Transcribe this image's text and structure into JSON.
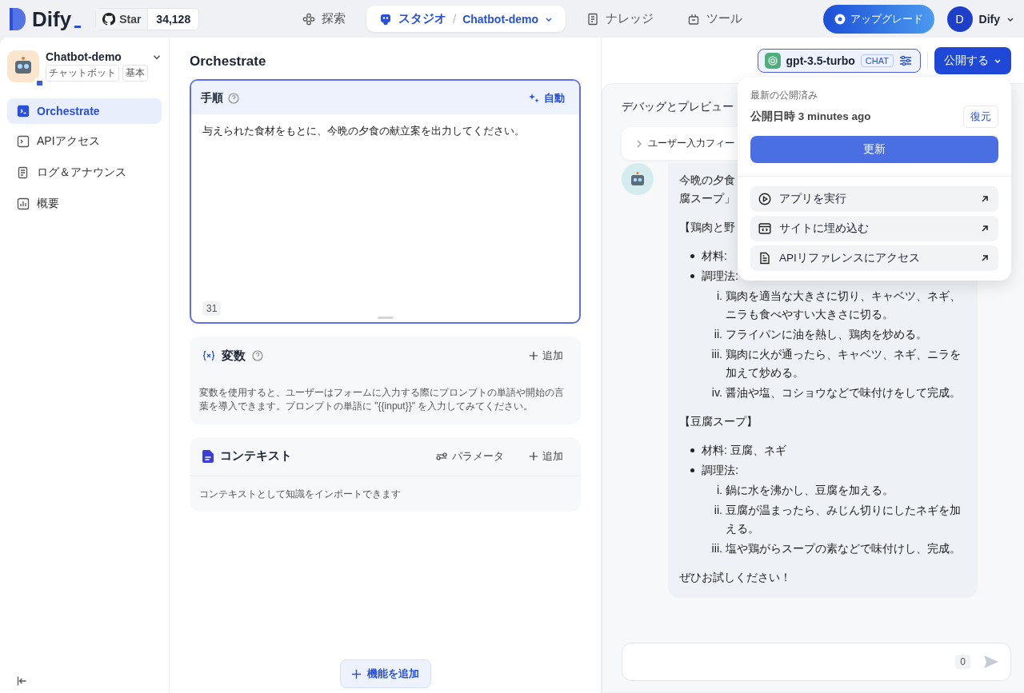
{
  "nav": {
    "logo": "Dify",
    "star": {
      "label": "Star",
      "count": "34,128"
    },
    "items": [
      {
        "kind": "explore",
        "label": "探索",
        "selected": false
      },
      {
        "kind": "studio",
        "label": "スタジオ",
        "separator": "/",
        "app": "Chatbot-demo",
        "selected": true
      },
      {
        "kind": "knowledge",
        "label": "ナレッジ",
        "selected": false
      },
      {
        "kind": "tools",
        "label": "ツール",
        "selected": false
      }
    ],
    "upgrade": "アップグレード",
    "user": {
      "initial": "D",
      "name": "Dify"
    }
  },
  "app": {
    "name": "Chatbot-demo",
    "tags": [
      "チャットボット",
      "基本"
    ]
  },
  "sidebar": {
    "items": [
      {
        "kind": "orchestrate",
        "label": "Orchestrate",
        "selected": true
      },
      {
        "kind": "api",
        "label": "APIアクセス",
        "selected": false
      },
      {
        "kind": "logs",
        "label": "ログ＆アナウンス",
        "selected": false
      },
      {
        "kind": "overview",
        "label": "概要",
        "selected": false
      }
    ]
  },
  "page_title": "Orchestrate",
  "model": {
    "name": "gpt-3.5-turbo",
    "mode": "CHAT"
  },
  "publish_button": "公開する",
  "prompt": {
    "title": "手順",
    "auto": "自動",
    "text": "与えられた食材をもとに、今晩の夕食の献立案を出力してください。",
    "count": "31"
  },
  "variables": {
    "title": "変数",
    "add": "追加",
    "description": "変数を使用すると、ユーザーはフォームに入力する際にプロンプトの単語や開始の言葉を導入できます。プロンプトの単語に \"{{input}}\" を入力してみてください。"
  },
  "context": {
    "title": "コンテキスト",
    "params": "パラメータ",
    "add": "追加",
    "description": "コンテキストとして知識をインポートできます"
  },
  "add_feature": "機能を追加",
  "debug": {
    "title": "デバッグとプレビュー",
    "user_input": "ユーザー入力フィー",
    "input_count": "0",
    "blocks": [
      {
        "kind": "para",
        "lines": [
          "今晩の夕食",
          "腐スープ」"
        ]
      },
      {
        "kind": "para",
        "lines": [
          "【鶏肉と野"
        ]
      },
      {
        "kind": "list",
        "items": [
          {
            "text": "材料:"
          },
          {
            "text": "調理法:",
            "children": [
              {
                "num": "i.",
                "text": "鶏肉を適当な大きさに切り、キャベツ、ネギ、ニラも食べやすい大きさに切る。"
              },
              {
                "num": "ii.",
                "text": "フライパンに油を熱し、鶏肉を炒める。"
              },
              {
                "num": "iii.",
                "text": "鶏肉に火が通ったら、キャベツ、ネギ、ニラを加えて炒める。"
              },
              {
                "num": "iv.",
                "text": "醤油や塩、コショウなどで味付けをして完成。"
              }
            ]
          }
        ]
      },
      {
        "kind": "para",
        "lines": [
          "【豆腐スープ】"
        ]
      },
      {
        "kind": "list",
        "items": [
          {
            "text": "材料: 豆腐、ネギ"
          },
          {
            "text": "調理法:",
            "children": [
              {
                "num": "i.",
                "text": "鍋に水を沸かし、豆腐を加える。"
              },
              {
                "num": "ii.",
                "text": "豆腐が温まったら、みじん切りにしたネギを加える。"
              },
              {
                "num": "iii.",
                "text": "塩や鶏がらスープの素などで味付けし、完成。"
              }
            ]
          }
        ]
      },
      {
        "kind": "para",
        "lines": [
          "ぜひお試しください！"
        ]
      }
    ]
  },
  "publish_menu": {
    "heading": "最新の公開済み",
    "published": "公開日時 3 minutes ago",
    "restore": "復元",
    "update": "更新",
    "actions": [
      {
        "kind": "run",
        "label": "アプリを実行"
      },
      {
        "kind": "embed",
        "label": "サイトに埋め込む"
      },
      {
        "kind": "api",
        "label": "APIリファレンスにアクセス"
      }
    ]
  }
}
